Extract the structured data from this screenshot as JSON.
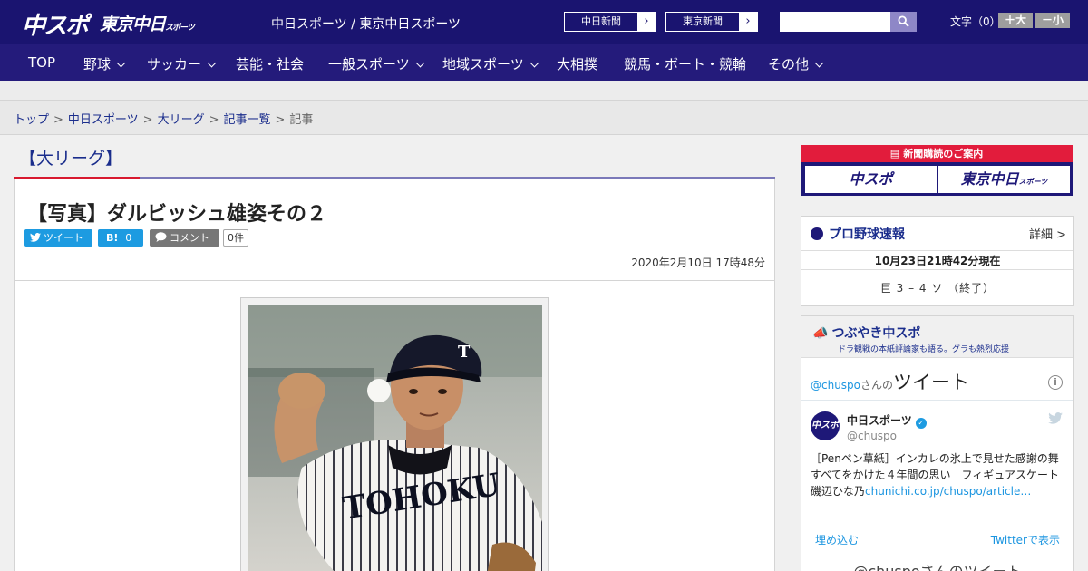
{
  "header": {
    "logo_chuspo": "中スポ",
    "logo_tokyo": "東京中日",
    "logo_tokyo_small": "スポーツ",
    "site_links": "中日スポーツ / 東京中日スポーツ",
    "ext_buttons": [
      "中日新聞",
      "東京新聞"
    ],
    "search_placeholder": "",
    "font_size_label": "文字（0）",
    "font_plus": "＋大",
    "font_minus": "－小"
  },
  "nav": [
    {
      "label": "TOP",
      "has_menu": false
    },
    {
      "label": "野球",
      "has_menu": true
    },
    {
      "label": "サッカー",
      "has_menu": true
    },
    {
      "label": "芸能・社会",
      "has_menu": false
    },
    {
      "label": "一般スポーツ",
      "has_menu": true
    },
    {
      "label": "地域スポーツ",
      "has_menu": true
    },
    {
      "label": "大相撲",
      "has_menu": false
    },
    {
      "label": "競馬・ボート・競輪",
      "has_menu": false
    },
    {
      "label": "その他",
      "has_menu": true
    }
  ],
  "breadcrumb": {
    "items": [
      "トップ",
      "中日スポーツ",
      "大リーグ",
      "記事一覧"
    ],
    "current": "記事",
    "separator": ">"
  },
  "article": {
    "category": "【大リーグ】",
    "title": "【写真】ダルビッシュ雄姿その２",
    "share": {
      "tweet": "ツイート",
      "hatena": "B!",
      "hatena_count": "0",
      "comment": "コメント",
      "comment_count": "0件"
    },
    "date": "2020年2月10日 17時48分",
    "photo_jersey_text": "TOHOKU"
  },
  "sidebar": {
    "subscribe": {
      "head": "新聞購読のご案内",
      "logo_left": "中スポ",
      "logo_right": "東京中日",
      "logo_right_small": "スポーツ"
    },
    "baseball": {
      "title": "プロ野球速報",
      "detail": "詳細 >",
      "time": "10月23日21時42分現在",
      "score": "巨 3 – 4 ソ （終了）"
    },
    "tweets": {
      "title": "つぶやき中スポ",
      "subtitle": "ドラ観戦の本紙評論家も語る。グラも熱烈応援",
      "handle_link": "@chuspo",
      "handle_suffix": "さんの",
      "heading": "ツイート",
      "avatar_text": "中スポ",
      "account_name": "中日スポーツ",
      "account_handle": "@chuspo",
      "body_text": "［Penペン草紙］インカレの氷上で見せた感謝の舞　すべてをかけた４年間の思い　フィギュアスケート　磯辺ひな乃",
      "body_link": "chunichi.co.jp/chuspo/article…",
      "embed": "埋め込む",
      "view_on": "Twitterで表示",
      "footer": "@chuspoさんのツイート"
    }
  },
  "colors": {
    "header_bg": "#1a1470",
    "nav_bg": "#241b7b",
    "accent_red": "#d8192f",
    "link_blue": "#1a2d8c",
    "twitter_blue": "#1d9be1"
  }
}
